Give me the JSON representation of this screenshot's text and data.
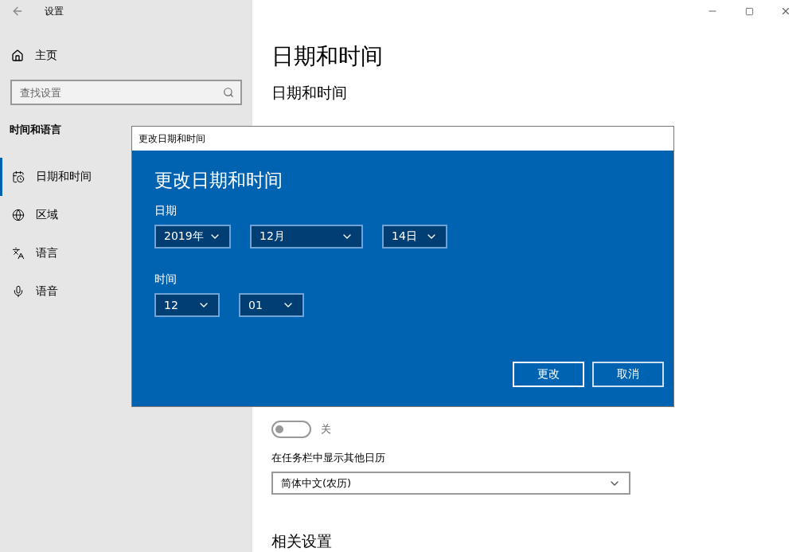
{
  "window": {
    "title": "设置"
  },
  "sidebar": {
    "home": "主页",
    "search": {
      "placeholder": "查找设置"
    },
    "section": "时间和语言",
    "items": [
      {
        "label": "日期和时间",
        "selected": true
      },
      {
        "label": "区域",
        "selected": false
      },
      {
        "label": "语言",
        "selected": false
      },
      {
        "label": "语音",
        "selected": false
      }
    ]
  },
  "main": {
    "title": "日期和时间",
    "subtitle": "日期和时间",
    "toggle": {
      "on": false,
      "label": "关"
    },
    "calendar_label": "在任务栏中显示其他日历",
    "calendar_select": "简体中文(农历)",
    "related": "相关设置"
  },
  "dialog": {
    "title": "更改日期和时间",
    "heading": "更改日期和时间",
    "date_label": "日期",
    "date_fields": [
      "2019年",
      "12月",
      "14日"
    ],
    "time_label": "时间",
    "time_fields": [
      "12",
      "01"
    ],
    "buttons": [
      {
        "label": "更改",
        "kind": "primary"
      },
      {
        "label": "取消",
        "kind": "secondary"
      }
    ]
  }
}
